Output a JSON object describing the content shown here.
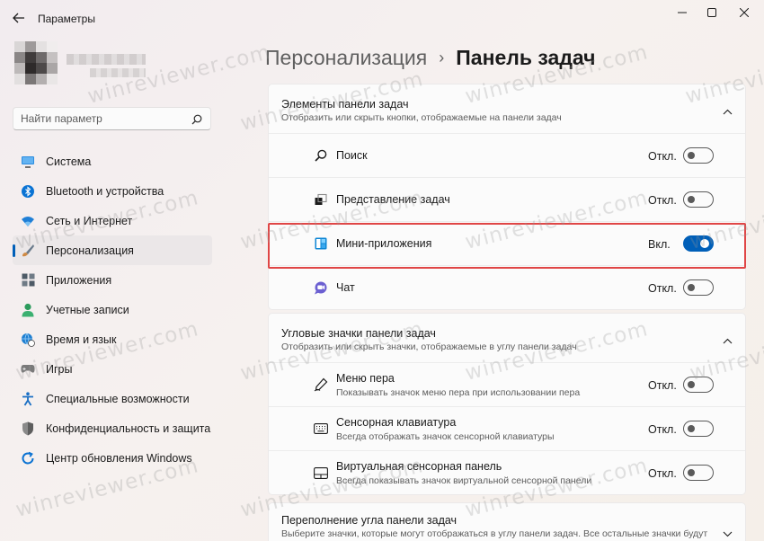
{
  "window": {
    "title": "Параметры",
    "back_icon": "arrow-left-icon",
    "controls": [
      "minimize-icon",
      "maximize-icon",
      "close-icon"
    ]
  },
  "search": {
    "placeholder": "Найти параметр",
    "icon": "search-icon"
  },
  "sidebar": {
    "items": [
      {
        "label": "Система",
        "icon": "display-icon",
        "color": "#0078d4"
      },
      {
        "label": "Bluetooth и устройства",
        "icon": "bluetooth-icon",
        "color": "#0078d4"
      },
      {
        "label": "Сеть и Интернет",
        "icon": "wifi-icon",
        "color": "#1f7fd6"
      },
      {
        "label": "Персонализация",
        "icon": "brush-icon",
        "color": "#c27a3f",
        "active": true
      },
      {
        "label": "Приложения",
        "icon": "apps-icon",
        "color": "#4d5a66"
      },
      {
        "label": "Учетные записи",
        "icon": "person-icon",
        "color": "#2c9b5c"
      },
      {
        "label": "Время и язык",
        "icon": "globe-clock-icon",
        "color": "#1e7fd1"
      },
      {
        "label": "Игры",
        "icon": "gamepad-icon",
        "color": "#6b6b6b"
      },
      {
        "label": "Специальные возможности",
        "icon": "accessibility-icon",
        "color": "#1a6fc4"
      },
      {
        "label": "Конфиденциальность и защита",
        "icon": "shield-icon",
        "color": "#6a6a6a"
      },
      {
        "label": "Центр обновления Windows",
        "icon": "update-icon",
        "color": "#0a72d2"
      }
    ]
  },
  "breadcrumb": {
    "parent": "Персонализация",
    "separator": "›",
    "current": "Панель задач"
  },
  "sections": [
    {
      "title": "Элементы панели задач",
      "description": "Отобразить или скрыть кнопки, отображаемые на панели задач",
      "expanded": true,
      "items": [
        {
          "label": "Поиск",
          "icon": "search-icon",
          "state": "Откл.",
          "on": false
        },
        {
          "label": "Представление задач",
          "icon": "task-view-icon",
          "state": "Откл.",
          "on": false
        },
        {
          "label": "Мини-приложения",
          "icon": "widgets-icon",
          "state": "Вкл.",
          "on": true
        },
        {
          "label": "Чат",
          "icon": "chat-icon",
          "state": "Откл.",
          "on": false
        }
      ]
    },
    {
      "title": "Угловые значки панели задач",
      "description": "Отобразить или скрыть значки, отображаемые в углу панели задач",
      "expanded": true,
      "items": [
        {
          "label": "Меню пера",
          "sub": "Показывать значок меню пера при использовании пера",
          "icon": "pen-icon",
          "state": "Откл.",
          "on": false
        },
        {
          "label": "Сенсорная клавиатура",
          "sub": "Всегда отображать значок сенсорной клавиатуры",
          "icon": "keyboard-icon",
          "state": "Откл.",
          "on": false
        },
        {
          "label": "Виртуальная сенсорная панель",
          "sub": "Всегда показывать значок виртуальной сенсорной панели",
          "icon": "touchpad-icon",
          "state": "Откл.",
          "on": false
        }
      ]
    },
    {
      "title": "Переполнение угла панели задач",
      "description": "Выберите значки, которые могут отображаться в углу панели задач. Все остальные значки будут",
      "expanded": false
    }
  ],
  "watermark": "winreviewer.com",
  "colors": {
    "accent": "#005fb8",
    "highlight": "#e04646"
  }
}
